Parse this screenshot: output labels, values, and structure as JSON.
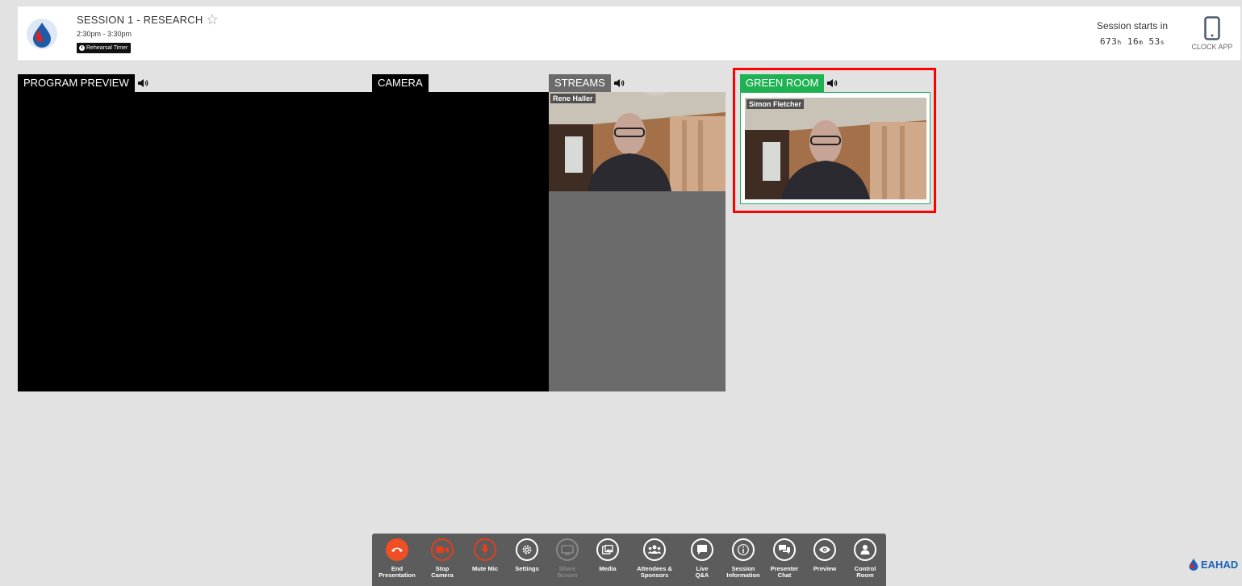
{
  "header": {
    "title": "SESSION 1 - RESEARCH",
    "time": "2:30pm - 3:30pm",
    "rehearsal_label": "Rehearsal Timer",
    "starts_label": "Session starts in",
    "countdown": {
      "hours": "673",
      "h": "h",
      "minutes": "16",
      "m": "m",
      "seconds": "53",
      "s": "s"
    },
    "clock_app_label": "CLOCK APP"
  },
  "panels": {
    "program_preview": "PROGRAM PREVIEW",
    "camera": "CAMERA",
    "streams": "STREAMS",
    "green_room": "GREEN ROOM"
  },
  "streams_tile": {
    "name": "Rene Haller"
  },
  "green_room_tile": {
    "name": "Simon Fletcher"
  },
  "toolbar": [
    {
      "id": "end",
      "label1": "End",
      "label2": "Presentation",
      "icon": "phone-hangup-icon"
    },
    {
      "id": "stop-camera",
      "label1": "Stop",
      "label2": "Camera",
      "icon": "video-camera-icon"
    },
    {
      "id": "mute",
      "label1": "Mute Mic",
      "label2": "",
      "icon": "microphone-icon"
    },
    {
      "id": "settings",
      "label1": "Settings",
      "label2": "",
      "icon": "gear-icon"
    },
    {
      "id": "share",
      "label1": "Share",
      "label2": "Screen",
      "icon": "monitor-icon"
    },
    {
      "id": "media",
      "label1": "Media",
      "label2": "",
      "icon": "media-icon"
    },
    {
      "id": "attendees",
      "label1": "Attendees &",
      "label2": "Sponsors",
      "icon": "people-icon"
    },
    {
      "id": "qa",
      "label1": "Live",
      "label2": "Q&A",
      "icon": "speech-bubble-icon"
    },
    {
      "id": "info",
      "label1": "Session",
      "label2": "Information",
      "icon": "info-icon"
    },
    {
      "id": "chat",
      "label1": "Presenter",
      "label2": "Chat",
      "icon": "chat-bubbles-icon"
    },
    {
      "id": "preview",
      "label1": "Preview",
      "label2": "",
      "icon": "eye-icon"
    },
    {
      "id": "control",
      "label1": "Control",
      "label2": "Room",
      "icon": "user-icon"
    }
  ],
  "brand": {
    "text": "EAHAD"
  },
  "colors": {
    "green_room": "#1fb253",
    "streams": "#6b6b6b",
    "highlight": "#ff0000",
    "end_button": "#f04f23",
    "brand": "#1a63b8"
  }
}
